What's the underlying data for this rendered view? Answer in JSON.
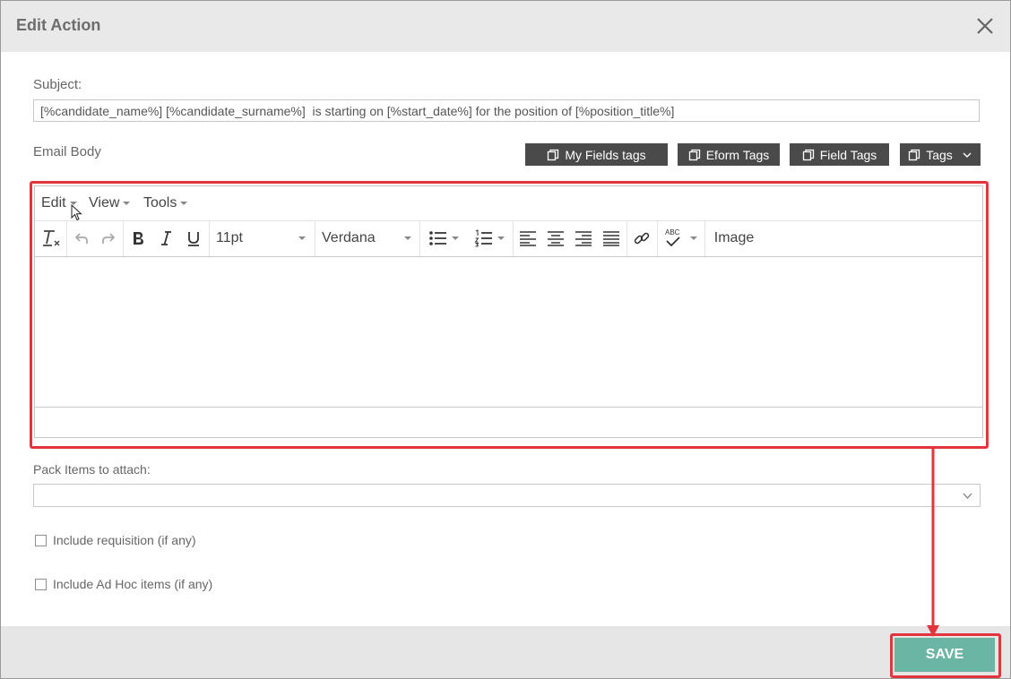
{
  "dialog": {
    "title": "Edit Action"
  },
  "subject": {
    "label": "Subject:",
    "value": "[%candidate_name%] [%candidate_surname%]  is starting on [%start_date%] for the position of [%position_title%]"
  },
  "email_body": {
    "label": "Email Body"
  },
  "tag_buttons": {
    "my_fields": "My Fields tags",
    "eform": "Eform Tags",
    "field": "Field Tags",
    "tags": "Tags"
  },
  "editor": {
    "menus": {
      "edit": "Edit",
      "view": "View",
      "tools": "Tools"
    },
    "font_size": "11pt",
    "font_family": "Verdana",
    "spellcheck_glyph": "ABC",
    "image_label": "Image"
  },
  "pack_items": {
    "label": "Pack Items to attach:",
    "value": ""
  },
  "checkboxes": {
    "requisition": {
      "label": "Include requisition (if any)",
      "checked": false
    },
    "adhoc": {
      "label": "Include Ad Hoc items (if any)",
      "checked": false
    }
  },
  "footer": {
    "save_label": "SAVE"
  },
  "colors": {
    "header_bg": "#e9e9e9",
    "tag_button_bg": "#4a4a4a",
    "save_bg": "#6ab5a3",
    "highlight": "#e2353e"
  }
}
